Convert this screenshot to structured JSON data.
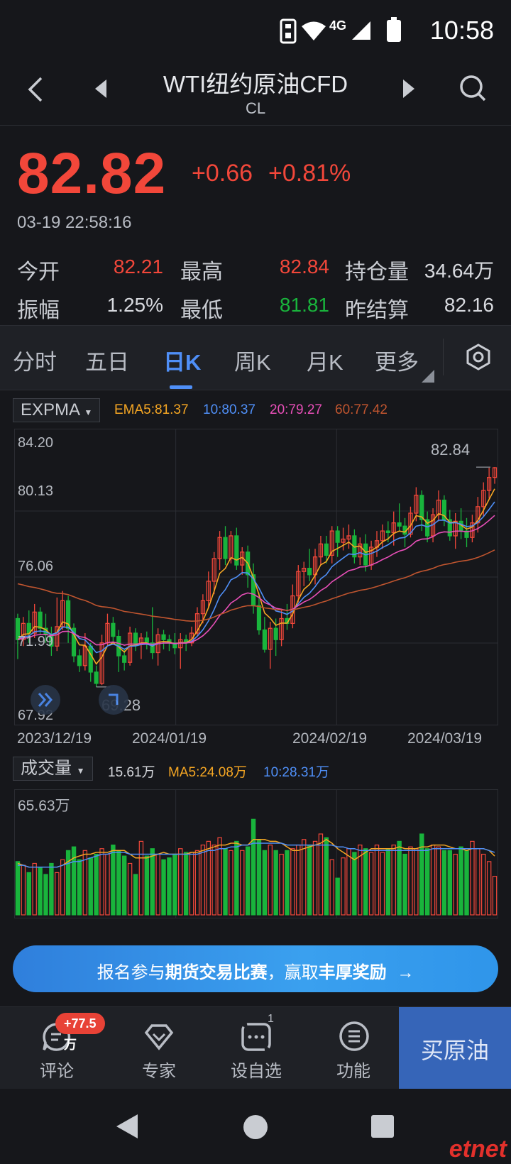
{
  "status_bar": {
    "network": "4G",
    "time": "10:58"
  },
  "header": {
    "title": "WTI纽约原油CFD",
    "code": "CL"
  },
  "quote": {
    "price": "82.82",
    "change": "+0.66",
    "change_pct": "+0.81%",
    "timestamp": "03-19 22:58:16"
  },
  "stats": {
    "open_label": "今开",
    "open": "82.21",
    "high_label": "最高",
    "high": "82.84",
    "oi_label": "持仓量",
    "oi": "34.64万",
    "amp_label": "振幅",
    "amp": "1.25%",
    "low_label": "最低",
    "low": "81.81",
    "prev_label": "昨结算",
    "prev": "82.16"
  },
  "tabs": [
    "分时",
    "五日",
    "日K",
    "周K",
    "月K",
    "更多"
  ],
  "active_tab": "日K",
  "indicator": {
    "name": "EXPMA",
    "ema5": "EMA5:81.37",
    "ema10": "10:80.37",
    "ema20": "20:79.27",
    "ema60": "60:77.42"
  },
  "volume_indicator": {
    "name": "成交量",
    "vol": "15.61万",
    "ma5": "MA5:24.08万",
    "ma10": "10:28.31万"
  },
  "colors": {
    "up": "#f2473a",
    "down": "#19b43c",
    "ema5": "#f5a623",
    "ema10": "#4f8ff7",
    "ema20": "#e84fb8",
    "ema60": "#c0552f",
    "accent": "#4f8ff7"
  },
  "chart_data": [
    {
      "type": "candlestick",
      "y_labels": [
        "84.20",
        "80.13",
        "76.06",
        "71.99",
        "67.92"
      ],
      "ylim": [
        67.92,
        84.2
      ],
      "x_labels": [
        "2023/12/19",
        "2024/01/19",
        "2024/02/19",
        "2024/03/19"
      ],
      "max_label": "82.84",
      "min_label": "69.28",
      "candles": [
        [
          73.5,
          72.2,
          73.8,
          71.0
        ],
        [
          72.2,
          73.2,
          73.6,
          71.8
        ],
        [
          73.2,
          72.6,
          74.0,
          72.0
        ],
        [
          72.6,
          73.9,
          74.4,
          72.3
        ],
        [
          73.9,
          72.9,
          74.2,
          72.5
        ],
        [
          72.9,
          72.5,
          73.8,
          72.0
        ],
        [
          72.5,
          71.8,
          73.0,
          71.2
        ],
        [
          71.8,
          73.0,
          74.8,
          71.5
        ],
        [
          73.0,
          74.6,
          75.2,
          72.8
        ],
        [
          74.6,
          72.9,
          74.9,
          72.0
        ],
        [
          72.9,
          71.2,
          73.2,
          70.8
        ],
        [
          71.2,
          70.6,
          71.6,
          70.2
        ],
        [
          70.6,
          71.8,
          72.6,
          70.3
        ],
        [
          71.8,
          70.2,
          72.0,
          69.6
        ],
        [
          70.2,
          69.5,
          70.6,
          69.28
        ],
        [
          69.5,
          72.0,
          72.5,
          69.4
        ],
        [
          72.0,
          73.2,
          73.8,
          71.8
        ],
        [
          73.2,
          72.4,
          73.6,
          72.0
        ],
        [
          72.4,
          71.2,
          72.8,
          70.2
        ],
        [
          71.2,
          70.8,
          71.6,
          70.3
        ],
        [
          70.8,
          72.6,
          73.0,
          70.6
        ],
        [
          72.6,
          71.9,
          72.9,
          71.5
        ],
        [
          71.9,
          72.3,
          72.6,
          71.0
        ],
        [
          72.3,
          72.0,
          72.7,
          71.6
        ],
        [
          72.0,
          71.4,
          74.2,
          71.0
        ],
        [
          71.4,
          72.5,
          72.9,
          70.6
        ],
        [
          72.5,
          72.2,
          72.8,
          71.6
        ],
        [
          72.2,
          72.0,
          72.5,
          71.5
        ],
        [
          72.0,
          71.7,
          72.6,
          71.3
        ],
        [
          71.7,
          72.2,
          72.6,
          70.4
        ],
        [
          72.2,
          72.0,
          72.5,
          71.5
        ],
        [
          72.0,
          72.6,
          73.0,
          71.8
        ],
        [
          72.6,
          73.8,
          74.2,
          72.4
        ],
        [
          73.8,
          74.6,
          75.0,
          73.2
        ],
        [
          74.6,
          75.8,
          76.4,
          74.2
        ],
        [
          75.8,
          77.2,
          77.6,
          75.0
        ],
        [
          77.2,
          78.5,
          78.9,
          76.5
        ],
        [
          78.5,
          77.2,
          79.2,
          76.8
        ],
        [
          77.2,
          78.6,
          78.9,
          76.9
        ],
        [
          78.6,
          76.8,
          79.1,
          76.5
        ],
        [
          76.8,
          77.6,
          77.9,
          76.2
        ],
        [
          77.6,
          76.2,
          78.0,
          75.4
        ],
        [
          76.2,
          74.3,
          76.9,
          73.8
        ],
        [
          74.3,
          72.8,
          75.1,
          72.5
        ],
        [
          72.8,
          71.6,
          73.6,
          71.4
        ],
        [
          71.6,
          72.9,
          73.3,
          70.4
        ],
        [
          72.9,
          72.2,
          73.5,
          71.2
        ],
        [
          72.2,
          73.5,
          74.1,
          71.8
        ],
        [
          73.5,
          73.2,
          74.4,
          72.8
        ],
        [
          73.2,
          74.9,
          75.6,
          72.9
        ],
        [
          74.9,
          76.4,
          76.8,
          74.5
        ],
        [
          76.4,
          76.6,
          77.0,
          75.5
        ],
        [
          76.6,
          76.2,
          77.8,
          75.8
        ],
        [
          76.2,
          77.3,
          77.8,
          75.6
        ],
        [
          77.3,
          78.1,
          78.6,
          76.8
        ],
        [
          78.1,
          77.4,
          78.6,
          76.9
        ],
        [
          77.4,
          78.9,
          79.2,
          76.9
        ],
        [
          78.9,
          78.2,
          79.2,
          77.3
        ],
        [
          78.2,
          78.4,
          79.1,
          77.7
        ],
        [
          78.4,
          78.6,
          79.3,
          77.8
        ],
        [
          78.6,
          77.3,
          79.0,
          76.9
        ],
        [
          77.3,
          78.1,
          78.5,
          76.8
        ],
        [
          78.1,
          76.8,
          78.7,
          76.4
        ],
        [
          76.8,
          77.9,
          78.3,
          76.5
        ],
        [
          77.9,
          78.3,
          78.9,
          77.3
        ],
        [
          78.3,
          78.9,
          79.3,
          77.8
        ],
        [
          78.9,
          78.8,
          79.5,
          78.2
        ],
        [
          78.8,
          79.4,
          80.1,
          78.0
        ],
        [
          79.4,
          79.2,
          80.6,
          78.9
        ],
        [
          79.2,
          78.7,
          79.7,
          77.9
        ],
        [
          78.7,
          80.0,
          80.4,
          78.5
        ],
        [
          80.0,
          81.1,
          81.6,
          79.5
        ],
        [
          81.1,
          79.6,
          81.4,
          78.9
        ],
        [
          79.6,
          78.6,
          80.1,
          78.2
        ],
        [
          78.6,
          79.9,
          80.3,
          78.2
        ],
        [
          79.9,
          80.8,
          81.4,
          79.5
        ],
        [
          80.8,
          79.6,
          81.1,
          79.2
        ],
        [
          79.6,
          78.6,
          80.2,
          78.3
        ],
        [
          78.6,
          79.5,
          80.0,
          77.8
        ],
        [
          79.5,
          78.9,
          80.3,
          78.4
        ],
        [
          78.9,
          78.5,
          79.7,
          77.9
        ],
        [
          78.5,
          79.4,
          79.9,
          78.2
        ],
        [
          79.4,
          80.4,
          81.0,
          78.8
        ],
        [
          80.4,
          81.4,
          81.9,
          79.8
        ],
        [
          81.4,
          82.2,
          82.8,
          80.9
        ],
        [
          82.2,
          82.8,
          82.84,
          81.81
        ]
      ]
    },
    {
      "type": "bar",
      "y_label": "65.63万",
      "ylim": [
        0,
        65.63
      ],
      "values": [
        29,
        27,
        23,
        28,
        26,
        22,
        28,
        23,
        30,
        35,
        37,
        30,
        35,
        31,
        33,
        36,
        33,
        38,
        35,
        32,
        28,
        22,
        40,
        32,
        36,
        33,
        30,
        31,
        33,
        36,
        34,
        34,
        35,
        38,
        40,
        38,
        42,
        36,
        35,
        40,
        35,
        37,
        52,
        41,
        35,
        38,
        35,
        33,
        35,
        36,
        38,
        41,
        38,
        40,
        44,
        42,
        30,
        20,
        31,
        36,
        34,
        38,
        36,
        34,
        38,
        34,
        36,
        38,
        40,
        33,
        37,
        36,
        44,
        36,
        38,
        37,
        35,
        35,
        33,
        37,
        35,
        40,
        36,
        33,
        29,
        21
      ],
      "ma5": [
        28,
        27,
        26,
        26,
        26,
        26,
        26,
        26,
        27,
        29,
        31,
        32,
        33,
        33,
        34,
        34,
        34,
        35,
        35,
        35,
        33,
        31,
        31,
        31,
        32,
        33,
        34,
        33,
        33,
        33,
        33,
        34,
        34,
        35,
        36,
        37,
        38,
        38,
        39,
        39,
        38,
        38,
        41,
        41,
        41,
        40,
        40,
        39,
        37,
        35,
        35,
        36,
        37,
        38,
        39,
        41,
        39,
        36,
        34,
        32,
        30,
        32,
        34,
        36,
        36,
        36,
        36,
        36,
        37,
        36,
        36,
        36,
        37,
        37,
        38,
        38,
        38,
        37,
        36,
        36,
        35,
        36,
        36,
        36,
        35,
        32
      ],
      "ma10": [
        27,
        27,
        26,
        26,
        26,
        26,
        26,
        26,
        27,
        28,
        29,
        29,
        30,
        31,
        32,
        33,
        33,
        34,
        34,
        34,
        33,
        33,
        33,
        33,
        33,
        33,
        33,
        33,
        33,
        33,
        33,
        33,
        33,
        34,
        35,
        35,
        36,
        36,
        37,
        37,
        38,
        38,
        39,
        39,
        39,
        39,
        39,
        39,
        38,
        38,
        38,
        38,
        38,
        38,
        38,
        38,
        38,
        37,
        37,
        36,
        36,
        35,
        35,
        35,
        35,
        35,
        35,
        35,
        35,
        35,
        35,
        35,
        35,
        35,
        36,
        36,
        36,
        36,
        36,
        36,
        36,
        36,
        36,
        36,
        35,
        34
      ]
    }
  ],
  "banner": {
    "prefix": "报名参与",
    "bold1": "期货交易比赛",
    "mid": "，赢取",
    "bold2": "丰厚奖励",
    "arrow": "→"
  },
  "bottom_nav": {
    "comment": "评论",
    "comment_badge": "+77.5万",
    "expert": "专家",
    "watchlist": "设自选",
    "watch_count": "1",
    "function": "功能",
    "buy": "买原油"
  },
  "watermark": "etnet"
}
